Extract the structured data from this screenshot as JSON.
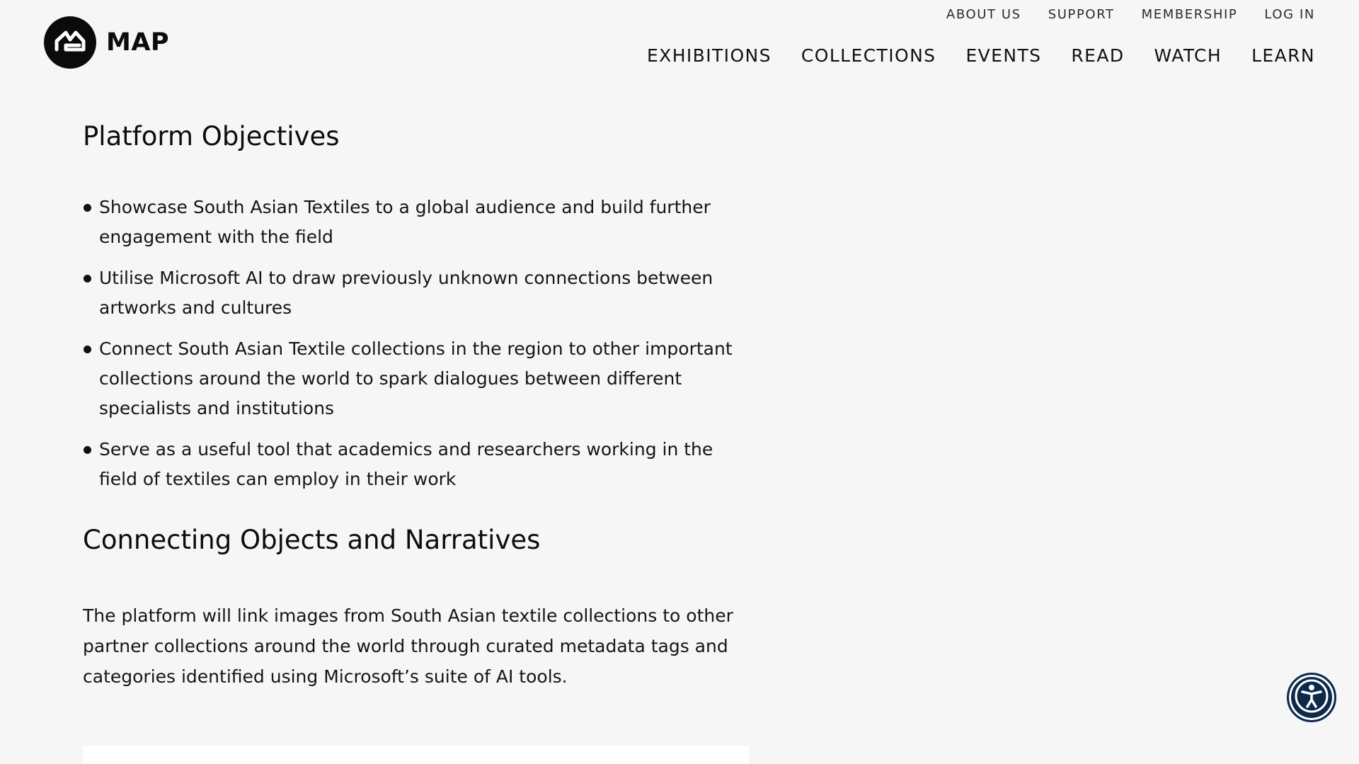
{
  "brand": {
    "logo_text": "MAP"
  },
  "utility_nav": {
    "about_us": "ABOUT US",
    "support": "SUPPORT",
    "membership": "MEMBERSHIP",
    "log_in": "LOG IN"
  },
  "main_nav": {
    "exhibitions": "EXHIBITIONS",
    "collections": "COLLECTIONS",
    "events": "EVENTS",
    "read": "READ",
    "watch": "WATCH",
    "learn": "LEARN"
  },
  "content": {
    "objectives_title": "Platform Objectives",
    "objectives": [
      "Showcase South Asian Textiles to a global audience and build further engagement with the field",
      "Utilise Microsoft AI to draw previously unknown connections between artworks and cultures",
      "Connect South Asian Textile collections in the region to other important collections around the world to spark dialogues between different specialists and institutions",
      "Serve as a useful tool that academics and researchers working in the field of textiles can employ in their work"
    ],
    "narratives_title": "Connecting Objects and Narratives",
    "narratives_paragraph": "The platform will link images from South Asian textile collections to other partner collections around the world through curated metadata tags and categories identified using Microsoft’s suite of AI tools."
  },
  "icons": {
    "logo": "map-logo-icon",
    "accessibility": "accessibility-icon"
  },
  "colors": {
    "background": "#f6f6f6",
    "text": "#111111",
    "accessibility_button": "#0d2a4b"
  }
}
